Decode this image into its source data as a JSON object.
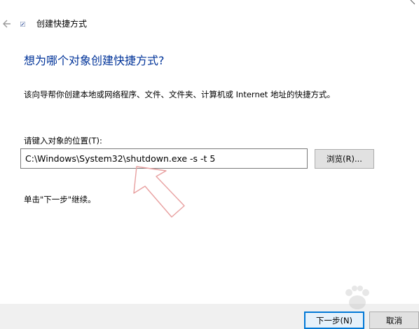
{
  "window": {
    "title": "创建快捷方式",
    "back_icon": "arrow-left-icon"
  },
  "wizard": {
    "heading": "想为哪个对象创建快捷方式?",
    "description": "该向导帮你创建本地或网络程序、文件、文件夹、计算机或 Internet 地址的快捷方式。",
    "location_label": "请键入对象的位置(T):",
    "location_value": "C:\\Windows\\System32\\shutdown.exe -s -t 5",
    "browse_label": "浏览(R)...",
    "continue_hint": "单击\"下一步\"继续。"
  },
  "footer": {
    "next_label": "下一步(N)",
    "cancel_label": "取消"
  },
  "colors": {
    "heading": "#003399",
    "accent": "#0078d7",
    "annotation_arrow": "#e8a0a0"
  }
}
